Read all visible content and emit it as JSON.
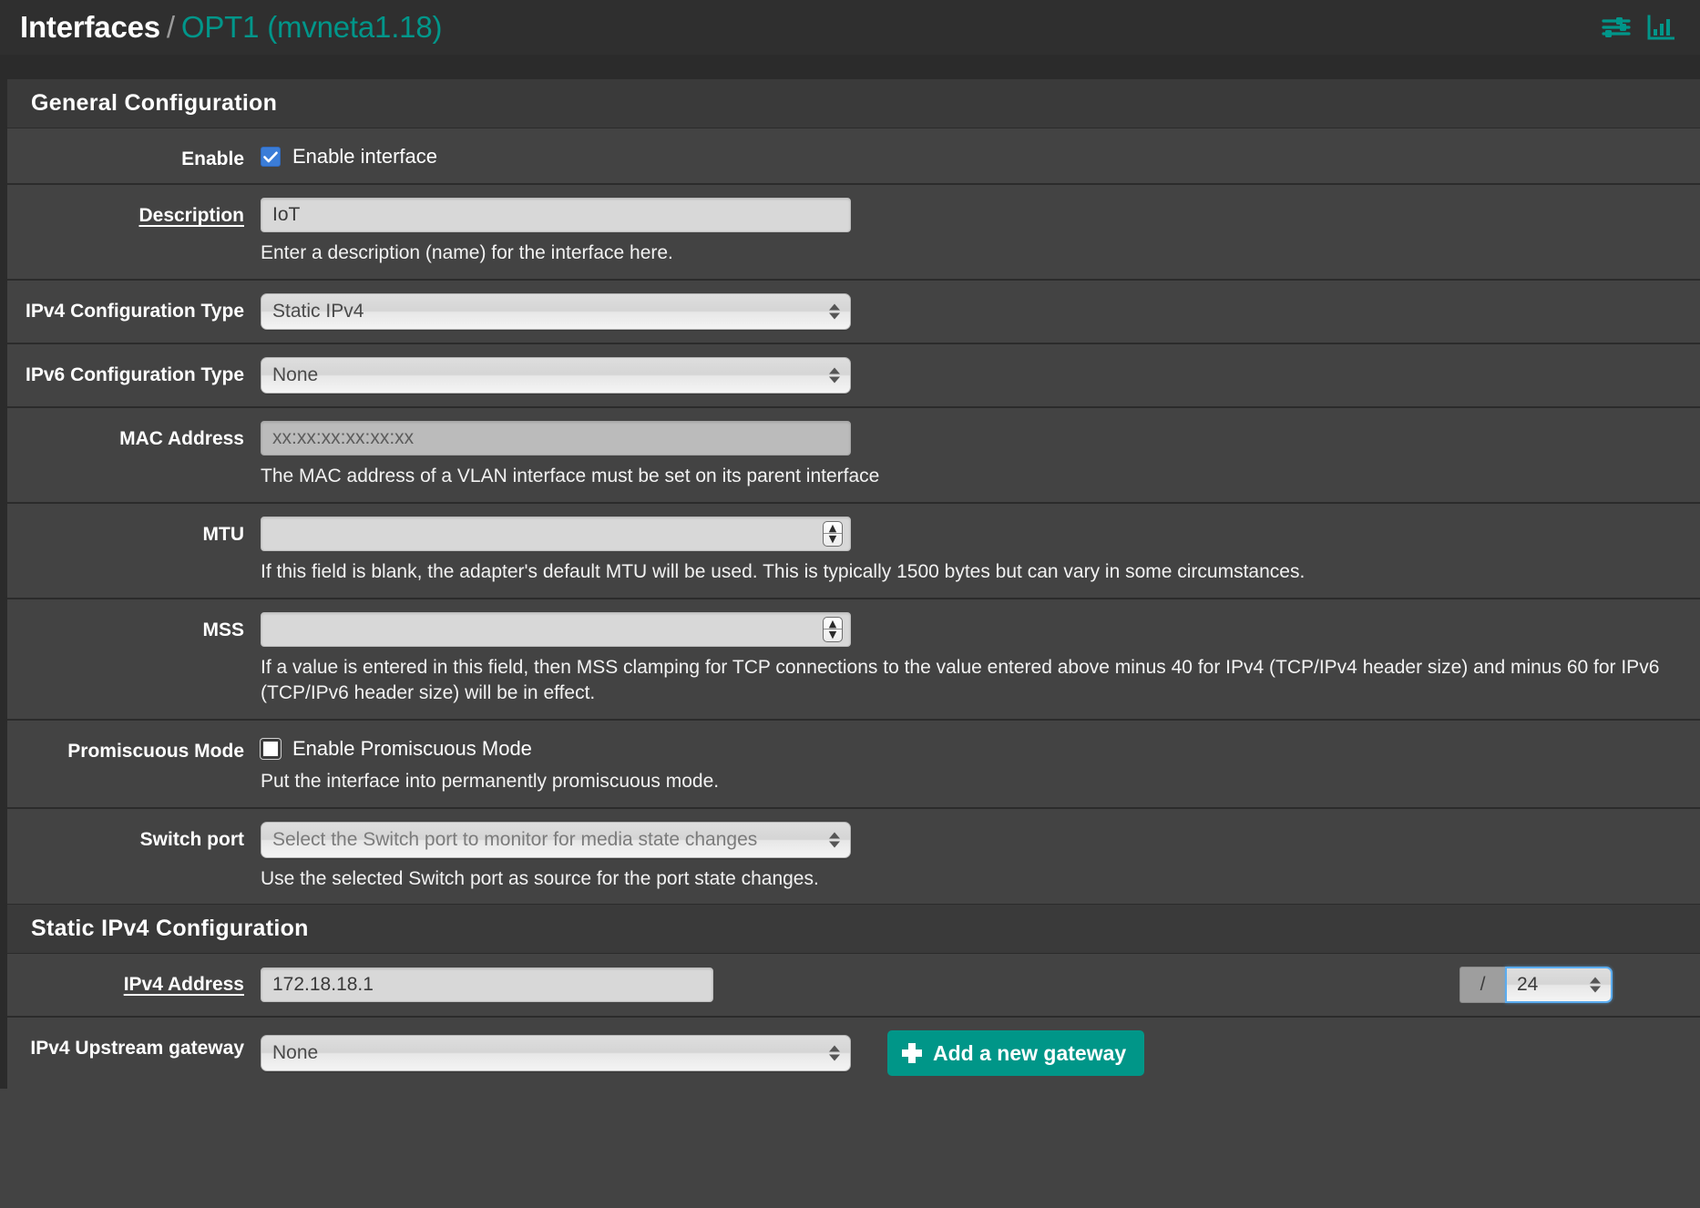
{
  "header": {
    "breadcrumb_root": "Interfaces",
    "breadcrumb_separator": "/",
    "breadcrumb_current": "OPT1 (mvneta1.18)",
    "icons": {
      "sliders": "sliders-icon",
      "chart": "bar-chart-icon"
    },
    "accent_color": "#00968a"
  },
  "sections": {
    "general": {
      "title": "General Configuration",
      "enable": {
        "label": "Enable",
        "checkbox_label": "Enable interface",
        "checked": true
      },
      "description": {
        "label": "Description",
        "value": "IoT",
        "help": "Enter a description (name) for the interface here."
      },
      "ipv4_config_type": {
        "label": "IPv4 Configuration Type",
        "value": "Static IPv4"
      },
      "ipv6_config_type": {
        "label": "IPv6 Configuration Type",
        "value": "None"
      },
      "mac_address": {
        "label": "MAC Address",
        "placeholder": "xx:xx:xx:xx:xx:xx",
        "value": "",
        "help": "The MAC address of a VLAN interface must be set on its parent interface"
      },
      "mtu": {
        "label": "MTU",
        "value": "",
        "help": "If this field is blank, the adapter's default MTU will be used. This is typically 1500 bytes but can vary in some circumstances."
      },
      "mss": {
        "label": "MSS",
        "value": "",
        "help": "If a value is entered in this field, then MSS clamping for TCP connections to the value entered above minus 40 for IPv4 (TCP/IPv4 header size) and minus 60 for IPv6 (TCP/IPv6 header size) will be in effect."
      },
      "promiscuous": {
        "label": "Promiscuous Mode",
        "checkbox_label": "Enable Promiscuous Mode",
        "checked": false,
        "help": "Put the interface into permanently promiscuous mode."
      },
      "switch_port": {
        "label": "Switch port",
        "value": "Select the Switch port to monitor for media state changes",
        "help": "Use the selected Switch port as source for the port state changes."
      }
    },
    "static_ipv4": {
      "title": "Static IPv4 Configuration",
      "ipv4_address": {
        "label": "IPv4 Address",
        "value": "172.18.18.1",
        "slash": "/",
        "cidr": "24"
      },
      "upstream_gateway": {
        "label": "IPv4 Upstream gateway",
        "value": "None",
        "add_button": "Add a new gateway"
      }
    }
  }
}
